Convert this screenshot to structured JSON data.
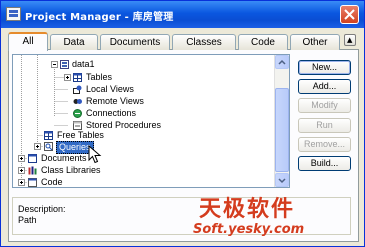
{
  "window": {
    "title": "Project Manager - 库房管理"
  },
  "tabs": [
    {
      "label": "All",
      "active": true
    },
    {
      "label": "Data",
      "active": false
    },
    {
      "label": "Documents",
      "active": false
    },
    {
      "label": "Classes",
      "active": false
    },
    {
      "label": "Code",
      "active": false
    },
    {
      "label": "Other",
      "active": false
    }
  ],
  "tab_scroll_label": "▲",
  "tree": {
    "nodes": [
      {
        "label": "data1",
        "icon": "database-icon",
        "expander": "minus"
      },
      {
        "label": "Tables",
        "icon": "table-icon",
        "expander": "plus"
      },
      {
        "label": "Local Views",
        "icon": "local-view-icon",
        "expander": "none"
      },
      {
        "label": "Remote Views",
        "icon": "remote-view-icon",
        "expander": "none"
      },
      {
        "label": "Connections",
        "icon": "connection-icon",
        "expander": "none"
      },
      {
        "label": "Stored Procedures",
        "icon": "stored-procedure-icon",
        "expander": "none"
      },
      {
        "label": "Free Tables",
        "icon": "table-icon",
        "expander": "none"
      },
      {
        "label": "Queries",
        "icon": "query-icon",
        "expander": "plus",
        "selected": true
      },
      {
        "label": "Documents",
        "icon": "form-icon",
        "expander": "plus"
      },
      {
        "label": "Class Libraries",
        "icon": "class-library-icon",
        "expander": "plus"
      },
      {
        "label": "Code",
        "icon": "code-icon",
        "expander": "plus"
      }
    ]
  },
  "buttons": {
    "new": "New...",
    "add": "Add...",
    "modify": "Modify",
    "run": "Run",
    "remove": "Remove...",
    "build": "Build..."
  },
  "description": {
    "label": "Description:",
    "path_label": "Path"
  },
  "watermark": {
    "chinese": "天极软件",
    "url": "Soft.yesky.com"
  },
  "colors": {
    "titlebar": "#0a57e0",
    "selection": "#316ac5",
    "watermark": "#d43c1e"
  }
}
